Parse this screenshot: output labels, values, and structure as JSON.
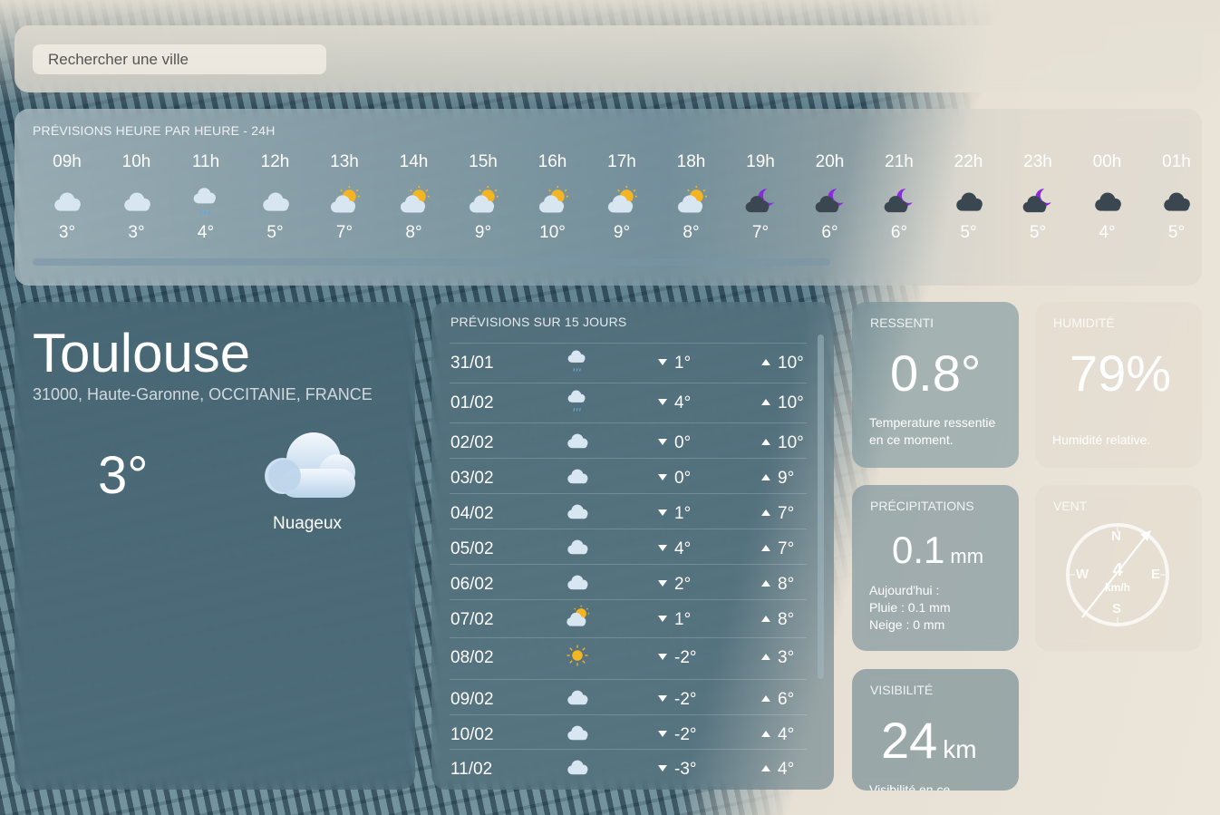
{
  "search": {
    "placeholder": "Rechercher une ville"
  },
  "hourly": {
    "title": "PRÉVISIONS HEURE PAR HEURE - 24H",
    "items": [
      {
        "hour": "09h",
        "icon": "cloud-icon",
        "temp": "3°"
      },
      {
        "hour": "10h",
        "icon": "cloud-icon",
        "temp": "3°"
      },
      {
        "hour": "11h",
        "icon": "rain-cloud-icon",
        "temp": "4°"
      },
      {
        "hour": "12h",
        "icon": "cloud-icon",
        "temp": "5°"
      },
      {
        "hour": "13h",
        "icon": "sun-cloud-icon",
        "temp": "7°"
      },
      {
        "hour": "14h",
        "icon": "sun-cloud-icon",
        "temp": "8°"
      },
      {
        "hour": "15h",
        "icon": "sun-cloud-icon",
        "temp": "9°"
      },
      {
        "hour": "16h",
        "icon": "sun-cloud-icon",
        "temp": "10°"
      },
      {
        "hour": "17h",
        "icon": "sun-cloud-icon",
        "temp": "9°"
      },
      {
        "hour": "18h",
        "icon": "sun-cloud-icon",
        "temp": "8°"
      },
      {
        "hour": "19h",
        "icon": "moon-cloud-icon",
        "temp": "7°"
      },
      {
        "hour": "20h",
        "icon": "moon-cloud-icon",
        "temp": "6°"
      },
      {
        "hour": "21h",
        "icon": "moon-cloud-icon",
        "temp": "6°"
      },
      {
        "hour": "22h",
        "icon": "dark-cloud-icon",
        "temp": "5°"
      },
      {
        "hour": "23h",
        "icon": "moon-cloud-icon",
        "temp": "5°"
      },
      {
        "hour": "00h",
        "icon": "dark-cloud-icon",
        "temp": "4°"
      },
      {
        "hour": "01h",
        "icon": "dark-cloud-icon",
        "temp": "5°"
      }
    ]
  },
  "city": {
    "name": "Toulouse",
    "location": "31000, Haute-Garonne, OCCITANIE, FRANCE",
    "temp": "3°",
    "condition": "Nuageux",
    "icon": "cloud-icon"
  },
  "daily": {
    "title": "PRÉVISIONS SUR 15 JOURS",
    "items": [
      {
        "date": "31/01",
        "icon": "rain-cloud-icon",
        "min": "1°",
        "max": "10°"
      },
      {
        "date": "01/02",
        "icon": "rain-cloud-icon",
        "min": "4°",
        "max": "10°"
      },
      {
        "date": "02/02",
        "icon": "cloud-icon",
        "min": "0°",
        "max": "10°"
      },
      {
        "date": "03/02",
        "icon": "cloud-icon",
        "min": "0°",
        "max": "9°"
      },
      {
        "date": "04/02",
        "icon": "cloud-icon",
        "min": "1°",
        "max": "7°"
      },
      {
        "date": "05/02",
        "icon": "cloud-icon",
        "min": "4°",
        "max": "7°"
      },
      {
        "date": "06/02",
        "icon": "cloud-icon",
        "min": "2°",
        "max": "8°"
      },
      {
        "date": "07/02",
        "icon": "sun-cloud-icon",
        "min": "1°",
        "max": "8°"
      },
      {
        "date": "08/02",
        "icon": "sun-icon",
        "min": "-2°",
        "max": "3°"
      },
      {
        "date": "09/02",
        "icon": "cloud-icon",
        "min": "-2°",
        "max": "6°"
      },
      {
        "date": "10/02",
        "icon": "cloud-icon",
        "min": "-2°",
        "max": "4°"
      },
      {
        "date": "11/02",
        "icon": "cloud-icon",
        "min": "-3°",
        "max": "4°"
      }
    ]
  },
  "feels_like": {
    "title": "RESSENTI",
    "value": "0.8°",
    "desc_line1": "Temperature ressentie",
    "desc_line2": "en ce moment."
  },
  "humidity": {
    "title": "HUMIDITÉ",
    "value": "79%",
    "desc": "Humidité relative."
  },
  "precipitation": {
    "title": "PRÉCIPITATIONS",
    "value": "0.1",
    "unit": "mm",
    "line1": "Aujourd'hui :",
    "line2": "Pluie : 0.1 mm",
    "line3": "Neige : 0 mm"
  },
  "wind": {
    "title": "VENT",
    "speed": "4",
    "unit": "km/h",
    "n": "N",
    "s": "S",
    "e": "E",
    "w": "W",
    "direction_icon": "arrow-icon"
  },
  "visibility": {
    "title": "VISIBILITÉ",
    "value": "24",
    "unit": "km",
    "desc": "Visibilité en ce"
  },
  "colors": {
    "sun": "#f5b520",
    "moon": "#8a2be2",
    "cloud": "#d8e6f2",
    "dark_cloud": "#3a4650"
  }
}
